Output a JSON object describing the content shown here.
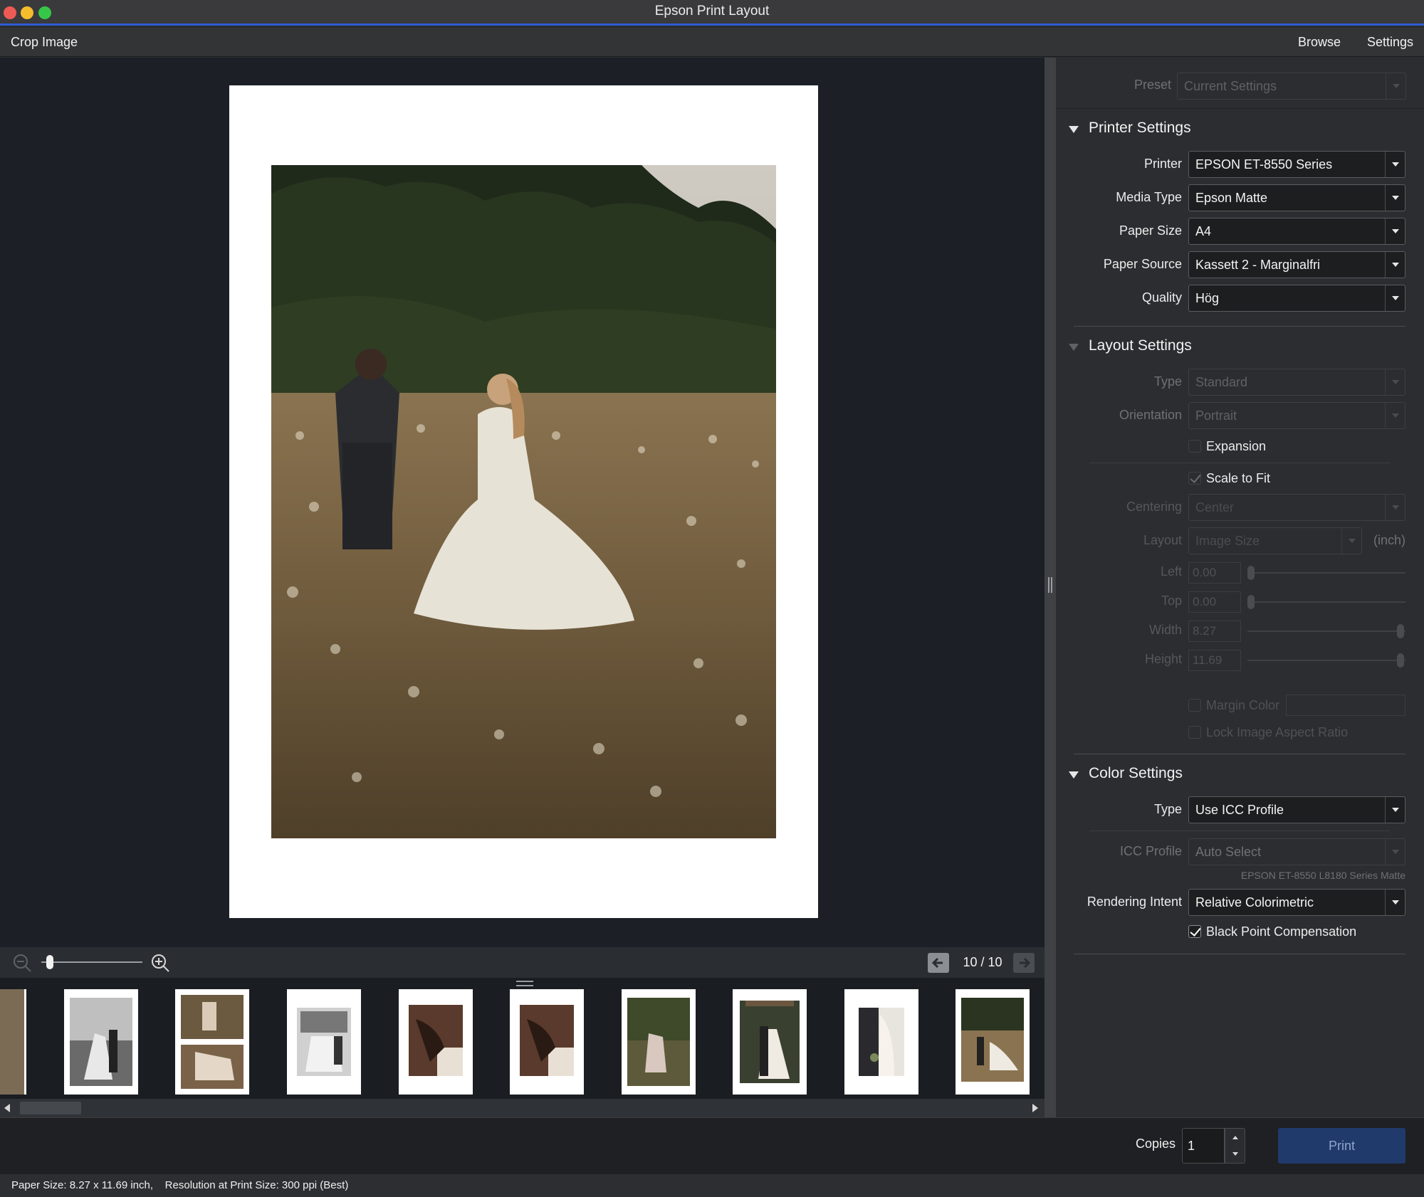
{
  "window": {
    "title": "Epson Print Layout",
    "colors": {
      "close": "#ee5b54",
      "minimize": "#f5bd2e",
      "maximize": "#36c748"
    }
  },
  "toolbar": {
    "crop_label": "Crop Image",
    "browse_label": "Browse",
    "settings_label": "Settings"
  },
  "preview": {
    "page_counter": "10 / 10",
    "zoom_level": 0.05
  },
  "panel": {
    "preset": {
      "label": "Preset",
      "value": "Current Settings"
    },
    "printer_settings": {
      "title": "Printer Settings",
      "printer": {
        "label": "Printer",
        "value": "EPSON ET-8550 Series"
      },
      "media_type": {
        "label": "Media Type",
        "value": "Epson Matte"
      },
      "paper_size": {
        "label": "Paper Size",
        "value": "A4"
      },
      "paper_source": {
        "label": "Paper Source",
        "value": "Kassett 2 - Marginalfri"
      },
      "quality": {
        "label": "Quality",
        "value": "Hög"
      }
    },
    "layout_settings": {
      "title": "Layout Settings",
      "type": {
        "label": "Type",
        "value": "Standard"
      },
      "orientation": {
        "label": "Orientation",
        "value": "Portrait"
      },
      "expansion": {
        "label": "Expansion",
        "checked": false
      },
      "scale_to_fit": {
        "label": "Scale to Fit",
        "checked": true
      },
      "centering": {
        "label": "Centering",
        "value": "Center"
      },
      "layout": {
        "label": "Layout",
        "value": "Image Size",
        "unit": "(inch)"
      },
      "left": {
        "label": "Left",
        "value": "0.00"
      },
      "top": {
        "label": "Top",
        "value": "0.00"
      },
      "width": {
        "label": "Width",
        "value": "8.27"
      },
      "height": {
        "label": "Height",
        "value": "11.69"
      },
      "margin_color": {
        "label": "Margin Color",
        "checked": false
      },
      "lock_aspect": {
        "label": "Lock Image Aspect Ratio",
        "checked": false
      }
    },
    "color_settings": {
      "title": "Color Settings",
      "type": {
        "label": "Type",
        "value": "Use ICC Profile"
      },
      "icc_profile": {
        "label": "ICC Profile",
        "value": "Auto Select",
        "note": "EPSON ET-8550 L8180 Series Matte"
      },
      "rendering_intent": {
        "label": "Rendering Intent",
        "value": "Relative Colorimetric"
      },
      "black_point": {
        "label": "Black Point Compensation",
        "checked": true
      }
    }
  },
  "bottom": {
    "copies_label": "Copies",
    "copies_value": "1",
    "print_label": "Print",
    "print_color": "#1f3a6b"
  },
  "status": {
    "text": "Paper Size: 8.27 x 11.69 inch,    Resolution at Print Size: 300 ppi (Best)"
  }
}
